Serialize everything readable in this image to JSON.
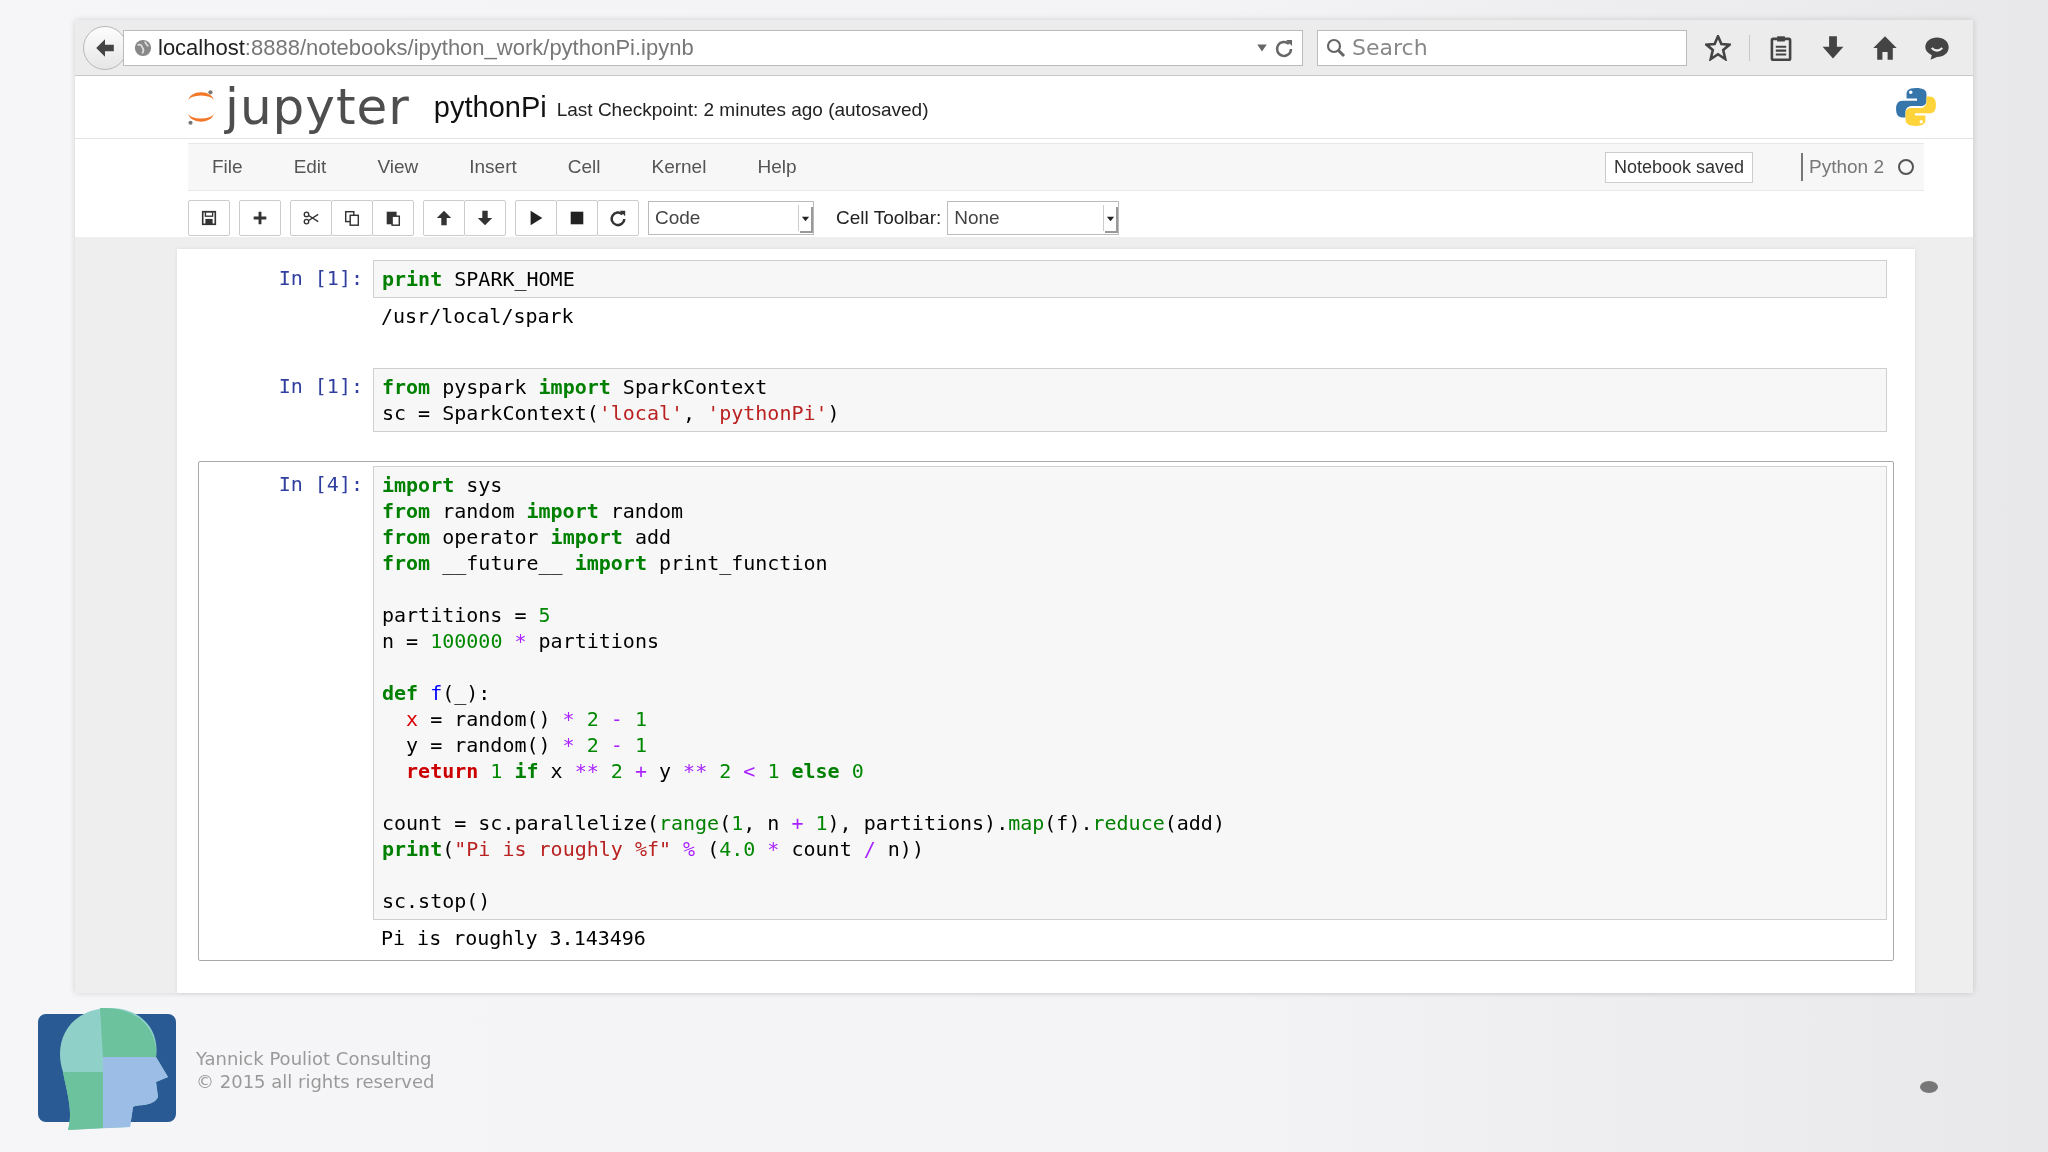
{
  "browser": {
    "url_host": "localhost",
    "url_path": ":8888/notebooks/ipython_work/pythonPi.ipynb",
    "search": {
      "placeholder": "Search"
    }
  },
  "notebook": {
    "logo_text": "jupyter",
    "name": "pythonPi",
    "checkpoint": "Last Checkpoint: 2 minutes ago (autosaved)",
    "menu": [
      "File",
      "Edit",
      "View",
      "Insert",
      "Cell",
      "Kernel",
      "Help"
    ],
    "status": "Notebook saved",
    "kernel": {
      "name": "Python 2",
      "busy": false
    },
    "toolbar": {
      "cell_type": "Code",
      "cell_toolbar_label": "Cell Toolbar:",
      "cell_toolbar": "None"
    }
  },
  "cells": [
    {
      "prompt": "In [1]:",
      "selected": false,
      "output": "/usr/local/spark",
      "lines": [
        {
          "kind": "code",
          "tokens": [
            {
              "kind": "kw",
              "text": "print"
            },
            {
              "kind": "plain",
              "text": " SPARK_HOME"
            }
          ]
        }
      ]
    },
    {
      "prompt": "In [1]:",
      "selected": false,
      "lines": [
        {
          "kind": "code",
          "tokens": [
            {
              "kind": "kw",
              "text": "from"
            },
            {
              "kind": "plain",
              "text": " pyspark "
            },
            {
              "kind": "kw",
              "text": "import"
            },
            {
              "kind": "plain",
              "text": " SparkContext"
            }
          ]
        },
        {
          "kind": "code",
          "tokens": [
            {
              "kind": "plain",
              "text": "sc = SparkContext("
            },
            {
              "kind": "str",
              "text": "'local'"
            },
            {
              "kind": "plain",
              "text": ", "
            },
            {
              "kind": "str",
              "text": "'pythonPi'"
            },
            {
              "kind": "plain",
              "text": ")"
            }
          ]
        }
      ]
    },
    {
      "prompt": "In [4]:",
      "selected": true,
      "output": "Pi is roughly 3.143496",
      "lines": [
        {
          "kind": "code",
          "tokens": [
            {
              "kind": "kw",
              "text": "import"
            },
            {
              "kind": "plain",
              "text": " sys"
            }
          ]
        },
        {
          "kind": "code",
          "tokens": [
            {
              "kind": "kw",
              "text": "from"
            },
            {
              "kind": "plain",
              "text": " random "
            },
            {
              "kind": "kw",
              "text": "import"
            },
            {
              "kind": "plain",
              "text": " random"
            }
          ]
        },
        {
          "kind": "code",
          "tokens": [
            {
              "kind": "kw",
              "text": "from"
            },
            {
              "kind": "plain",
              "text": " operator "
            },
            {
              "kind": "kw",
              "text": "import"
            },
            {
              "kind": "plain",
              "text": " add"
            }
          ]
        },
        {
          "kind": "code",
          "tokens": [
            {
              "kind": "kw",
              "text": "from"
            },
            {
              "kind": "plain",
              "text": " __future__ "
            },
            {
              "kind": "kw",
              "text": "import"
            },
            {
              "kind": "plain",
              "text": " print_function"
            }
          ]
        },
        {
          "kind": "blank"
        },
        {
          "kind": "code",
          "tokens": [
            {
              "kind": "plain",
              "text": "partitions = "
            },
            {
              "kind": "num",
              "text": "5"
            }
          ]
        },
        {
          "kind": "code",
          "tokens": [
            {
              "kind": "plain",
              "text": "n = "
            },
            {
              "kind": "num",
              "text": "100000"
            },
            {
              "kind": "op",
              "text": " *"
            },
            {
              "kind": "plain",
              "text": " partitions"
            }
          ]
        },
        {
          "kind": "blank"
        },
        {
          "kind": "code",
          "tokens": [
            {
              "kind": "kw",
              "text": "def"
            },
            {
              "kind": "def",
              "text": " f"
            },
            {
              "kind": "plain",
              "text": "(_):"
            }
          ]
        },
        {
          "kind": "code",
          "tokens": [
            {
              "kind": "var",
              "text": "  x"
            },
            {
              "kind": "plain",
              "text": " = random()"
            },
            {
              "kind": "op",
              "text": " *"
            },
            {
              "kind": "num",
              "text": " 2"
            },
            {
              "kind": "op",
              "text": " -"
            },
            {
              "kind": "num",
              "text": " 1"
            }
          ]
        },
        {
          "kind": "code",
          "tokens": [
            {
              "kind": "plain",
              "text": "  y = random()"
            },
            {
              "kind": "op",
              "text": " *"
            },
            {
              "kind": "num",
              "text": " 2"
            },
            {
              "kind": "op",
              "text": " -"
            },
            {
              "kind": "num",
              "text": " 1"
            }
          ]
        },
        {
          "kind": "code",
          "tokens": [
            {
              "kind": "ret",
              "text": "  return"
            },
            {
              "kind": "num",
              "text": " 1"
            },
            {
              "kind": "kw",
              "text": " if"
            },
            {
              "kind": "plain",
              "text": " x"
            },
            {
              "kind": "op",
              "text": " **"
            },
            {
              "kind": "num",
              "text": " 2"
            },
            {
              "kind": "op",
              "text": " +"
            },
            {
              "kind": "plain",
              "text": " y"
            },
            {
              "kind": "op",
              "text": " **"
            },
            {
              "kind": "num",
              "text": " 2"
            },
            {
              "kind": "op",
              "text": " <"
            },
            {
              "kind": "num",
              "text": " 1"
            },
            {
              "kind": "kw",
              "text": " else"
            },
            {
              "kind": "num",
              "text": " 0"
            }
          ]
        },
        {
          "kind": "blank"
        },
        {
          "kind": "code",
          "tokens": [
            {
              "kind": "plain",
              "text": "count = sc.parallelize("
            },
            {
              "kind": "builtin",
              "text": "range"
            },
            {
              "kind": "plain",
              "text": "("
            },
            {
              "kind": "num",
              "text": "1"
            },
            {
              "kind": "plain",
              "text": ", n"
            },
            {
              "kind": "op",
              "text": " +"
            },
            {
              "kind": "num",
              "text": " 1"
            },
            {
              "kind": "plain",
              "text": "), partitions)."
            },
            {
              "kind": "builtin",
              "text": "map"
            },
            {
              "kind": "plain",
              "text": "(f)."
            },
            {
              "kind": "builtin",
              "text": "reduce"
            },
            {
              "kind": "plain",
              "text": "(add)"
            }
          ]
        },
        {
          "kind": "code",
          "tokens": [
            {
              "kind": "kw",
              "text": "print"
            },
            {
              "kind": "plain",
              "text": "("
            },
            {
              "kind": "str",
              "text": "\"Pi is roughly %f\""
            },
            {
              "kind": "op",
              "text": " %"
            },
            {
              "kind": "plain",
              "text": " ("
            },
            {
              "kind": "num",
              "text": "4.0"
            },
            {
              "kind": "op",
              "text": " *"
            },
            {
              "kind": "plain",
              "text": " count"
            },
            {
              "kind": "op",
              "text": " /"
            },
            {
              "kind": "plain",
              "text": " n))"
            }
          ]
        },
        {
          "kind": "blank"
        },
        {
          "kind": "code",
          "tokens": [
            {
              "kind": "plain",
              "text": "sc.stop()"
            }
          ]
        }
      ]
    }
  ],
  "footer": {
    "company": "Yannick Pouliot Consulting",
    "copyright": "© 2015 all rights reserved"
  }
}
